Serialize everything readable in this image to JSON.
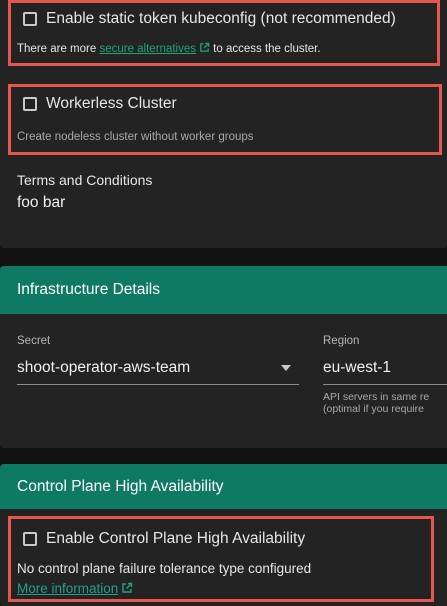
{
  "static_token": {
    "checkbox_label": "Enable static token kubeconfig (not recommended)",
    "hint_before": "There are more ",
    "hint_link": "secure alternatives",
    "hint_after": " to access the cluster.",
    "checked": false
  },
  "workerless": {
    "checkbox_label": "Workerless Cluster",
    "hint": "Create nodeless cluster without worker groups",
    "checked": false
  },
  "terms": {
    "label": "Terms and Conditions",
    "value": "foo bar"
  },
  "infrastructure": {
    "header": "Infrastructure Details",
    "secret_label": "Secret",
    "secret_value": "shoot-operator-aws-team",
    "region_label": "Region",
    "region_value": "eu-west-1",
    "region_hint_line1": "API servers in same re",
    "region_hint_line2": "(optimal if you require"
  },
  "control_plane": {
    "header": "Control Plane High Availability",
    "checkbox_label": "Enable Control Plane High Availability",
    "checked": false,
    "status_text": "No control plane failure tolerance type configured",
    "more_link": "More information"
  },
  "colors": {
    "accent": "#0e7a64",
    "link": "#1fa383",
    "highlight": "#e4574f",
    "card": "#232323",
    "background": "#121212"
  }
}
